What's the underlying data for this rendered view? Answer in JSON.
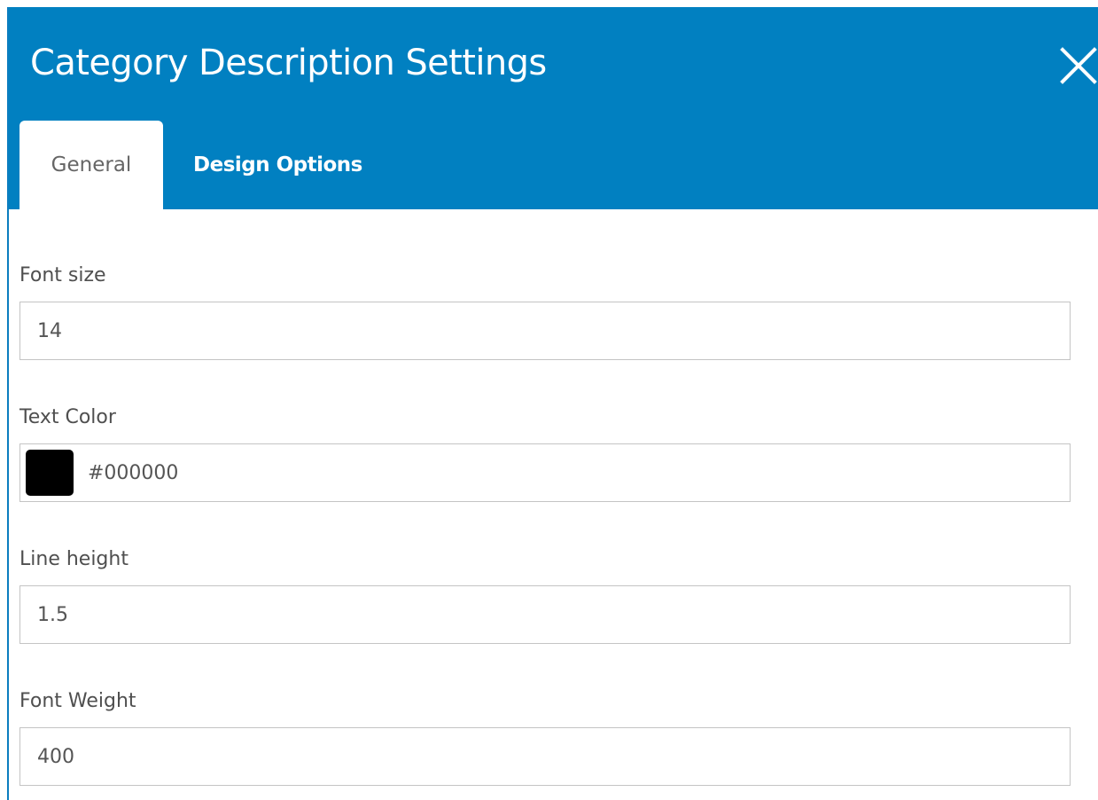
{
  "modal": {
    "title": "Category Description Settings",
    "close_icon": "close-icon",
    "header_color": "#0180C1"
  },
  "tabs": [
    {
      "label": "General",
      "active": true
    },
    {
      "label": "Design Options",
      "active": false
    }
  ],
  "fields": {
    "font_size": {
      "label": "Font size",
      "value": "14"
    },
    "text_color": {
      "label": "Text Color",
      "value": "#000000",
      "swatch_color": "#000000"
    },
    "line_height": {
      "label": "Line height",
      "value": "1.5"
    },
    "font_weight": {
      "label": "Font Weight",
      "value": "400"
    }
  }
}
